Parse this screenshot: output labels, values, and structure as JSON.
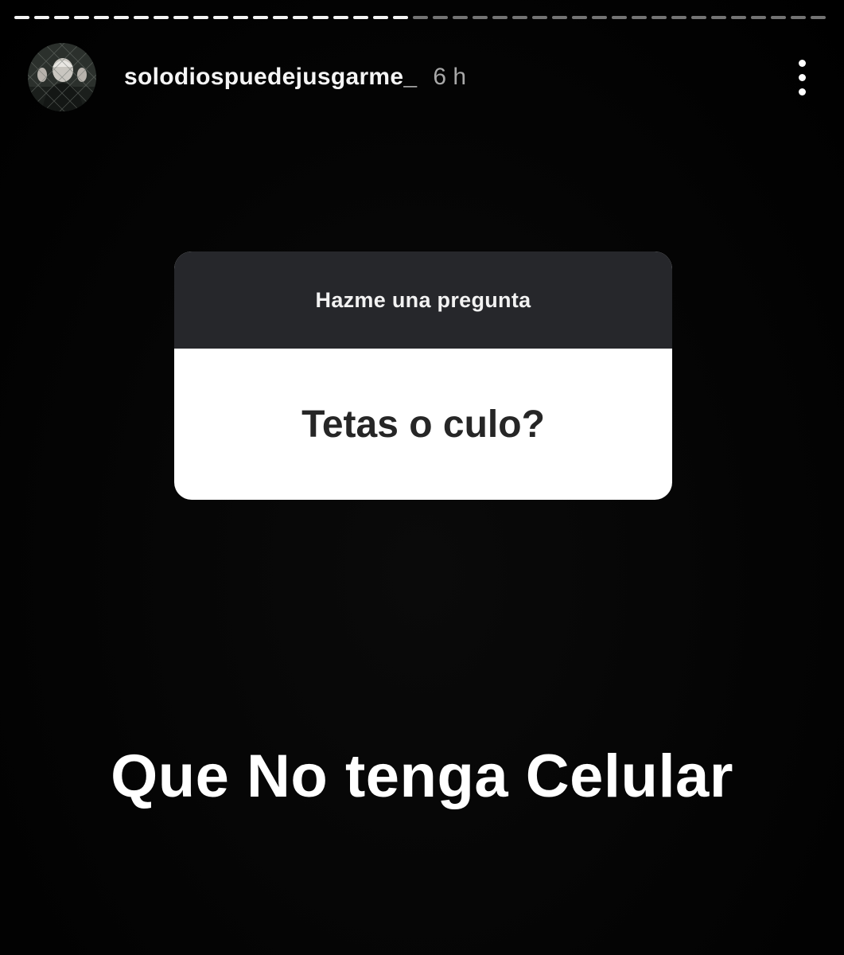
{
  "story": {
    "progress_segments": [
      {
        "state": "done"
      },
      {
        "state": "done"
      },
      {
        "state": "done"
      },
      {
        "state": "done"
      },
      {
        "state": "done"
      },
      {
        "state": "done"
      },
      {
        "state": "done"
      },
      {
        "state": "done"
      },
      {
        "state": "done"
      },
      {
        "state": "done"
      },
      {
        "state": "done"
      },
      {
        "state": "done"
      },
      {
        "state": "done"
      },
      {
        "state": "done"
      },
      {
        "state": "done"
      },
      {
        "state": "done"
      },
      {
        "state": "done"
      },
      {
        "state": "done"
      },
      {
        "state": "done"
      },
      {
        "state": "done"
      },
      {
        "state": "pending"
      },
      {
        "state": "pending"
      },
      {
        "state": "pending"
      },
      {
        "state": "pending"
      },
      {
        "state": "pending"
      },
      {
        "state": "pending"
      },
      {
        "state": "pending"
      },
      {
        "state": "pending"
      },
      {
        "state": "pending"
      },
      {
        "state": "pending"
      },
      {
        "state": "pending"
      },
      {
        "state": "pending"
      },
      {
        "state": "pending"
      },
      {
        "state": "pending"
      },
      {
        "state": "pending"
      },
      {
        "state": "pending"
      },
      {
        "state": "pending"
      },
      {
        "state": "pending"
      },
      {
        "state": "pending"
      },
      {
        "state": "pending"
      },
      {
        "state": "pending"
      }
    ]
  },
  "header": {
    "username": "solodiospuedejusgarme_",
    "time": "6 h",
    "avatar_icon": "profile-avatar",
    "more_icon": "more-vertical-icon"
  },
  "sticker": {
    "title": "Hazme una pregunta",
    "question": "Tetas o culo?"
  },
  "answer": {
    "text": "Que No tenga Celular"
  },
  "colors": {
    "background": "#000000",
    "sticker_header": "#26272b",
    "sticker_body": "#ffffff",
    "question_text": "#262626",
    "time_text": "#a8a8a8"
  }
}
